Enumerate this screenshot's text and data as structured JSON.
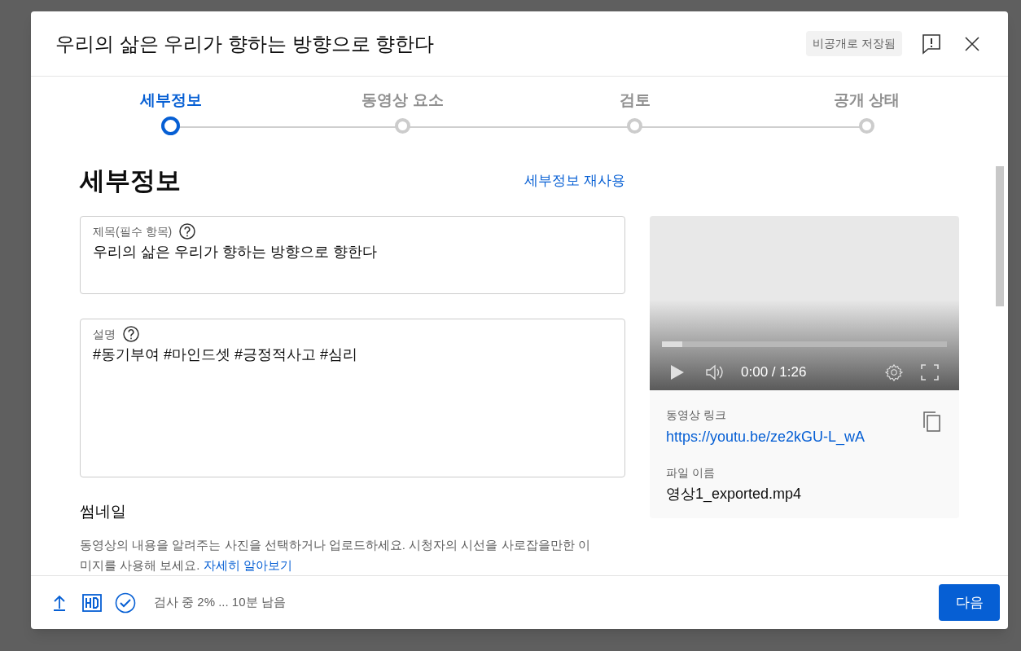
{
  "dialog": {
    "title": "우리의 삶은 우리가 향하는 방향으로 향한다",
    "save_status": "비공개로 저장됨"
  },
  "steps": [
    {
      "label": "세부정보",
      "selected": true
    },
    {
      "label": "동영상 요소",
      "selected": false
    },
    {
      "label": "검토",
      "selected": false
    },
    {
      "label": "공개 상태",
      "selected": false
    }
  ],
  "details": {
    "heading": "세부정보",
    "reuse_link": "세부정보 재사용",
    "title_field": {
      "label": "제목(필수 항목)",
      "value": "우리의 삶은 우리가 향하는 방향으로 향한다"
    },
    "description_field": {
      "label": "설명",
      "value": "#동기부여 #마인드셋 #긍정적사고 #심리"
    },
    "thumbnail": {
      "heading": "썸네일",
      "text": "동영상의 내용을 알려주는 사진을 선택하거나 업로드하세요. 시청자의 시선을 사로잡을만한 이미지를 사용해 보세요.",
      "link": "자세히 알아보기"
    }
  },
  "video": {
    "progress": {
      "level": 0.07
    },
    "time": "0:00 / 1:26",
    "link_label": "동영상 링크",
    "link": "https://youtu.be/ze2kGU-L_wA",
    "file_label": "파일 이름",
    "file_name": "영상1_exported.mp4"
  },
  "footer": {
    "status": "검사 중 2% ... 10분 남음",
    "next_button": "다음"
  }
}
